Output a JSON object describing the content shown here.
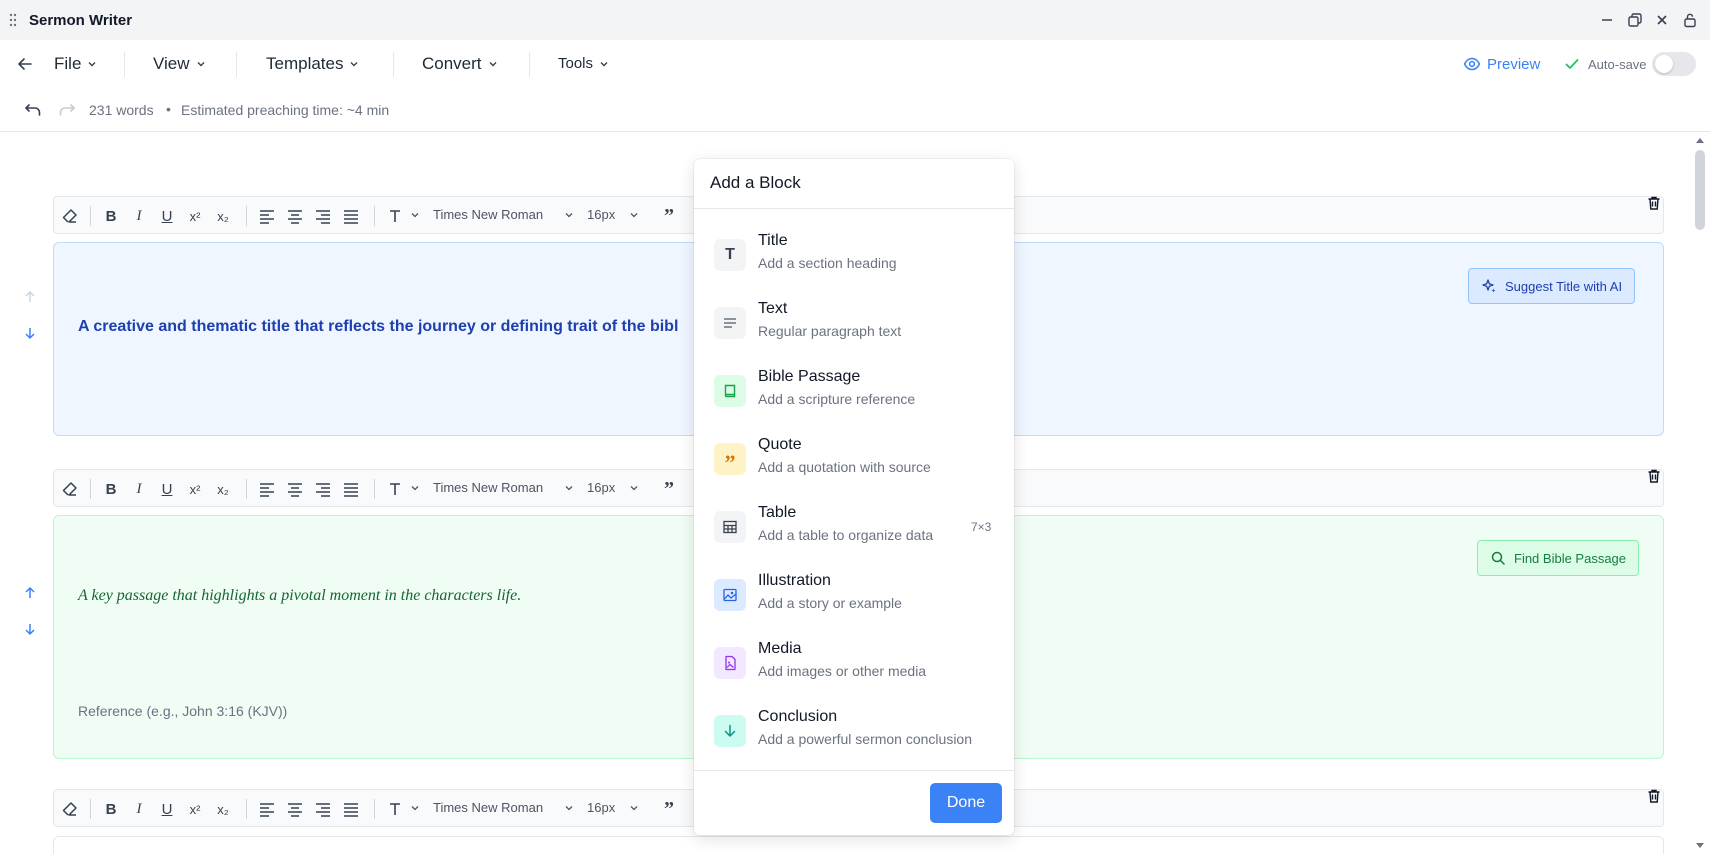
{
  "window": {
    "title": "Sermon Writer"
  },
  "menu": {
    "file": "File",
    "view": "View",
    "templates": "Templates",
    "convert": "Convert",
    "tools": "Tools",
    "preview": "Preview",
    "autosave": "Auto-save",
    "autosave_on": false
  },
  "status": {
    "words": "231 words",
    "separator": "•",
    "preaching_time": "Estimated preaching time: ~4 min"
  },
  "toolbar": {
    "font": "Times New Roman",
    "size": "16px"
  },
  "blocks": {
    "title": {
      "text": "A creative and thematic title that reflects the journey or defining trait of the bibl",
      "button": "Suggest Title with AI"
    },
    "bible": {
      "text": "A key passage that highlights a pivotal moment in the characters life.",
      "reference_placeholder": "Reference (e.g., John 3:16 (KJV))",
      "button": "Find Bible Passage"
    }
  },
  "modal": {
    "title": "Add a Block",
    "options": [
      {
        "name": "Title",
        "desc": "Add a section heading",
        "icon": "T-icon",
        "color": "#f3f4f6"
      },
      {
        "name": "Text",
        "desc": "Regular paragraph text",
        "icon": "text-lines-icon",
        "color": "#f3f4f6"
      },
      {
        "name": "Bible Passage",
        "desc": "Add a scripture reference",
        "icon": "book-icon",
        "color": "#dcfce7"
      },
      {
        "name": "Quote",
        "desc": "Add a quotation with source",
        "icon": "quote-icon",
        "color": "#fef3c7"
      },
      {
        "name": "Table",
        "desc": "Add a table to organize data",
        "icon": "table-icon",
        "color": "#f3f4f6",
        "meta": "7×3"
      },
      {
        "name": "Illustration",
        "desc": "Add a story or example",
        "icon": "image-icon",
        "color": "#dbeafe"
      },
      {
        "name": "Media",
        "desc": "Add images or other media",
        "icon": "media-file-icon",
        "color": "#f3e8ff"
      },
      {
        "name": "Conclusion",
        "desc": "Add a powerful sermon conclusion",
        "icon": "arrow-down-icon",
        "color": "#ccfbf1"
      }
    ],
    "done": "Done"
  },
  "colors": {
    "accent": "#3b82f6",
    "title_text": "#1e40af",
    "bible_text": "#166534"
  }
}
